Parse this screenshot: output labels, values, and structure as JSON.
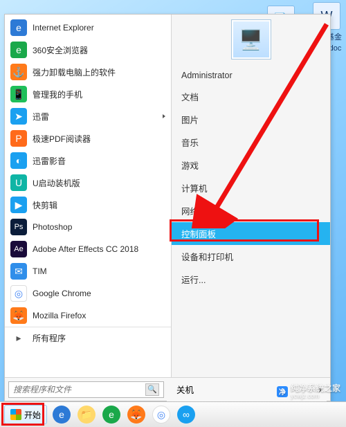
{
  "desktop": {
    "icons": [
      {
        "label": "计算基金",
        "sub": "益案.doc"
      }
    ],
    "faint_icon": "⬚"
  },
  "startMenu": {
    "user": "Administrator",
    "userPicEmoji": "👤",
    "apps": [
      {
        "label": "Internet Explorer",
        "bg": "#2d7ad6",
        "glyph": "e"
      },
      {
        "label": "360安全浏览器",
        "bg": "#1aa84a",
        "glyph": "e"
      },
      {
        "label": "强力卸载电脑上的软件",
        "bg": "#ff7a1a",
        "glyph": "⚓"
      },
      {
        "label": "管理我的手机",
        "bg": "#1fbf5a",
        "glyph": "📱"
      },
      {
        "label": "迅雷",
        "bg": "#1aa0f0",
        "glyph": "➤"
      },
      {
        "label": "极速PDF阅读器",
        "bg": "#ff6a1a",
        "glyph": "P"
      },
      {
        "label": "迅雷影音",
        "bg": "#1aa0f0",
        "glyph": "◐"
      },
      {
        "label": "U启动装机版",
        "bg": "#0fb5a5",
        "glyph": "U"
      },
      {
        "label": "快剪辑",
        "bg": "#1aa0f0",
        "glyph": "▶"
      },
      {
        "label": "Photoshop",
        "bg": "#0b1d3a",
        "glyph": "Ps"
      },
      {
        "label": "Adobe After Effects CC 2018",
        "bg": "#1a0b3a",
        "glyph": "Ae"
      },
      {
        "label": "TIM",
        "bg": "#2f8eea",
        "glyph": "✉"
      },
      {
        "label": "Google Chrome",
        "bg": "#ffffff",
        "glyph": "◎"
      },
      {
        "label": "Mozilla Firefox",
        "bg": "#ff7a1a",
        "glyph": "🦊"
      }
    ],
    "allPrograms": "所有程序",
    "search": {
      "placeholder": "搜索程序和文件",
      "glyph": "🔍"
    },
    "rightItems": [
      {
        "label": "Administrator"
      },
      {
        "label": "文档"
      },
      {
        "label": "图片"
      },
      {
        "label": "音乐"
      },
      {
        "label": "游戏"
      },
      {
        "label": "计算机"
      },
      {
        "label": "网络"
      },
      {
        "label": "控制面板",
        "highlight": true
      },
      {
        "label": "设备和打印机"
      },
      {
        "label": "运行..."
      }
    ],
    "shutdown": {
      "label": "关机"
    }
  },
  "taskbar": {
    "start": "开始",
    "icons": [
      {
        "name": "ie-icon",
        "bg": "#2d7ad6",
        "glyph": "e"
      },
      {
        "name": "explorer-icon",
        "bg": "#ffd86b",
        "glyph": "📁"
      },
      {
        "name": "browser360-icon",
        "bg": "#1aa84a",
        "glyph": "e"
      },
      {
        "name": "firefox-icon",
        "bg": "#ff7a1a",
        "glyph": "🦊"
      },
      {
        "name": "chrome-icon",
        "bg": "#ffffff",
        "glyph": "◎"
      },
      {
        "name": "other-icon",
        "bg": "#1aa0f0",
        "glyph": "∞"
      }
    ]
  },
  "watermark": {
    "text": "纯净系统之家",
    "url": "ycwjz.com"
  }
}
